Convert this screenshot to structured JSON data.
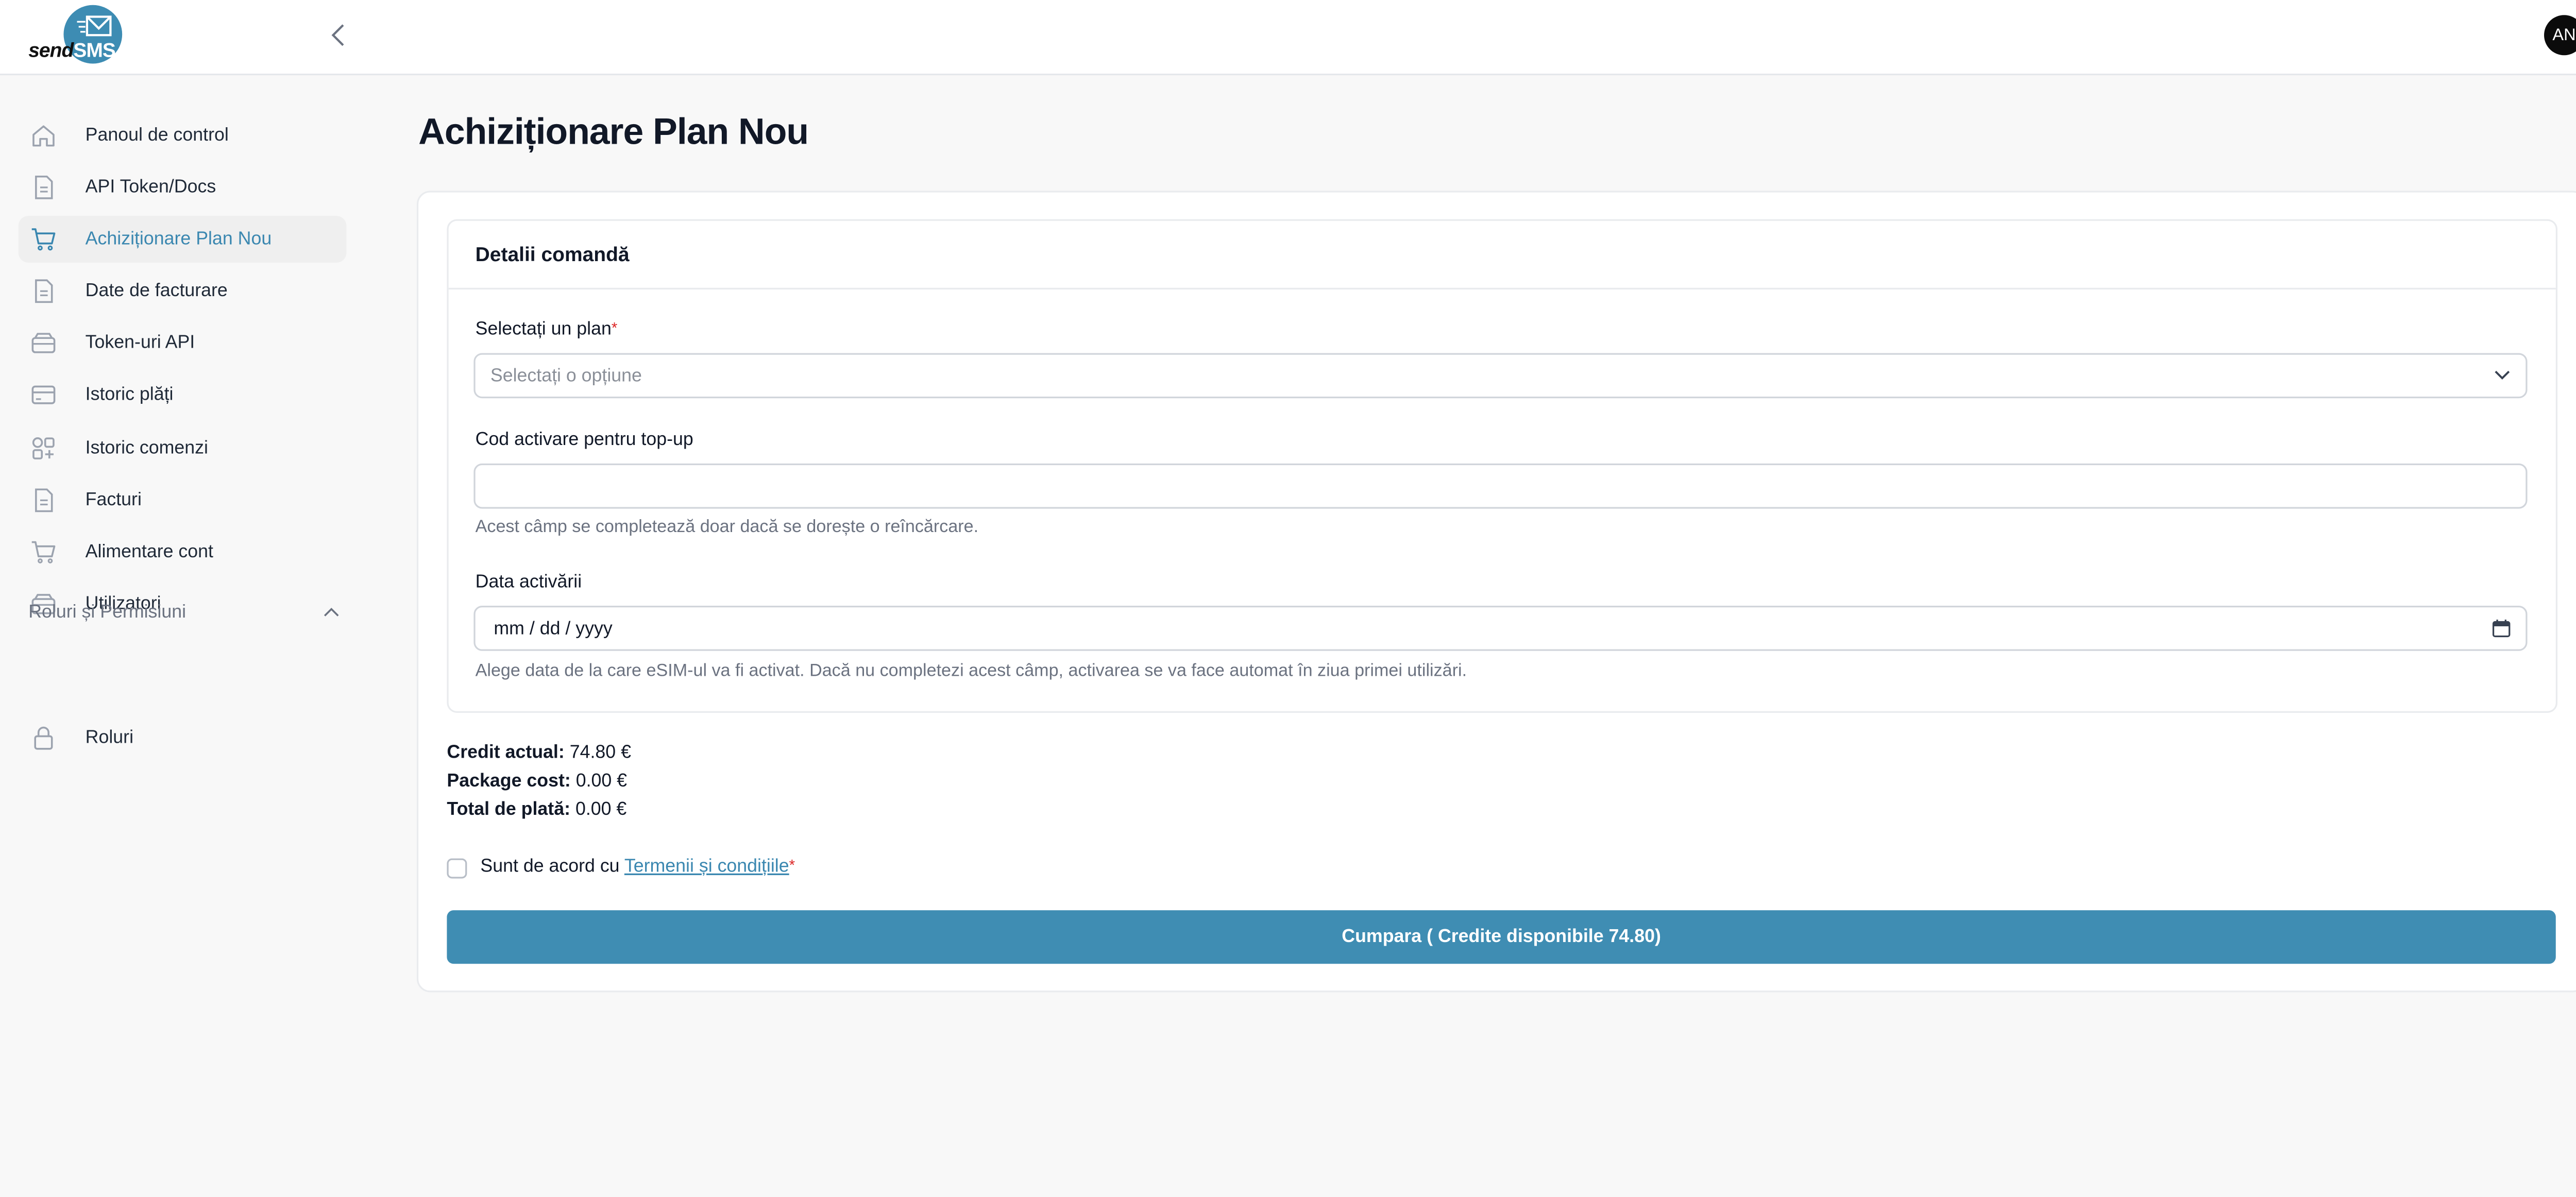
{
  "brand": {
    "logo_send": "send",
    "logo_sms": "SMS",
    "accent_color": "#3f8db3"
  },
  "header": {
    "avatar_initials": "AN"
  },
  "sidebar": {
    "items": [
      {
        "label": "Panoul de control",
        "icon": "home-icon"
      },
      {
        "label": "API Token/Docs",
        "icon": "document-icon"
      },
      {
        "label": "Achiziționare Plan Nou",
        "icon": "cart-icon",
        "active": true
      },
      {
        "label": "Date de facturare",
        "icon": "document-icon"
      },
      {
        "label": "Token-uri API",
        "icon": "wallet-icon"
      },
      {
        "label": "Istoric plăți",
        "icon": "credit-card-icon"
      },
      {
        "label": "Istoric comenzi",
        "icon": "grid-plus-icon"
      },
      {
        "label": "Facturi",
        "icon": "document-icon"
      },
      {
        "label": "Alimentare cont",
        "icon": "cart-icon"
      },
      {
        "label": "Utilizatori",
        "icon": "wallet-icon"
      }
    ],
    "section_title": "Roluri și Permisiuni",
    "section_items": [
      {
        "label": "Roluri",
        "icon": "lock-icon"
      }
    ]
  },
  "main": {
    "page_title": "Achiziționare Plan Nou",
    "card_title": "Detalii comandă",
    "plan_label": "Selectați un plan",
    "plan_placeholder": "Selectați o opțiune",
    "topup_label": "Cod activare pentru top-up",
    "topup_value": "",
    "topup_help": "Acest câmp se completează doar dacă se dorește o reîncărcare.",
    "date_label": "Data activării",
    "date_value": "mm / dd / yyyy",
    "date_help": "Alege data de la care eSIM-ul va fi activat. Dacă nu completezi acest câmp, activarea se va face automat în ziua primei utilizări.",
    "summary": {
      "credit_label": "Credit actual:",
      "credit_value": "74.80 €",
      "package_label": "Package cost:",
      "package_value": "0.00 €",
      "total_label": "Total de plată:",
      "total_value": "0.00 €"
    },
    "agree_text": "Sunt de acord cu",
    "terms_link": "Termenii și condițiile",
    "required_mark": "*",
    "buy_button": "Cumpara ( Credite disponibile 74.80)"
  }
}
